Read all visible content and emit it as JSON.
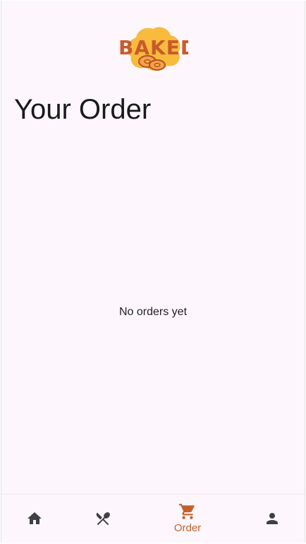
{
  "brand": {
    "logo_text": "BAKED",
    "colors": {
      "logo_blob": "#f8bb3e",
      "logo_text": "#c95a2b",
      "bagel_fill": "#f2a34b",
      "bagel_stroke": "#b84f22"
    }
  },
  "page": {
    "title": "Your Order",
    "empty_message": "No orders yet"
  },
  "bottom_nav": {
    "items": [
      {
        "id": "home",
        "icon": "home-icon",
        "label": "",
        "active": false
      },
      {
        "id": "menu",
        "icon": "utensils-icon",
        "label": "",
        "active": false
      },
      {
        "id": "order",
        "icon": "cart-icon",
        "label": "Order",
        "active": true
      },
      {
        "id": "profile",
        "icon": "person-icon",
        "label": "",
        "active": false
      }
    ],
    "colors": {
      "active": "#c5602b",
      "inactive": "#3f3f46"
    }
  }
}
